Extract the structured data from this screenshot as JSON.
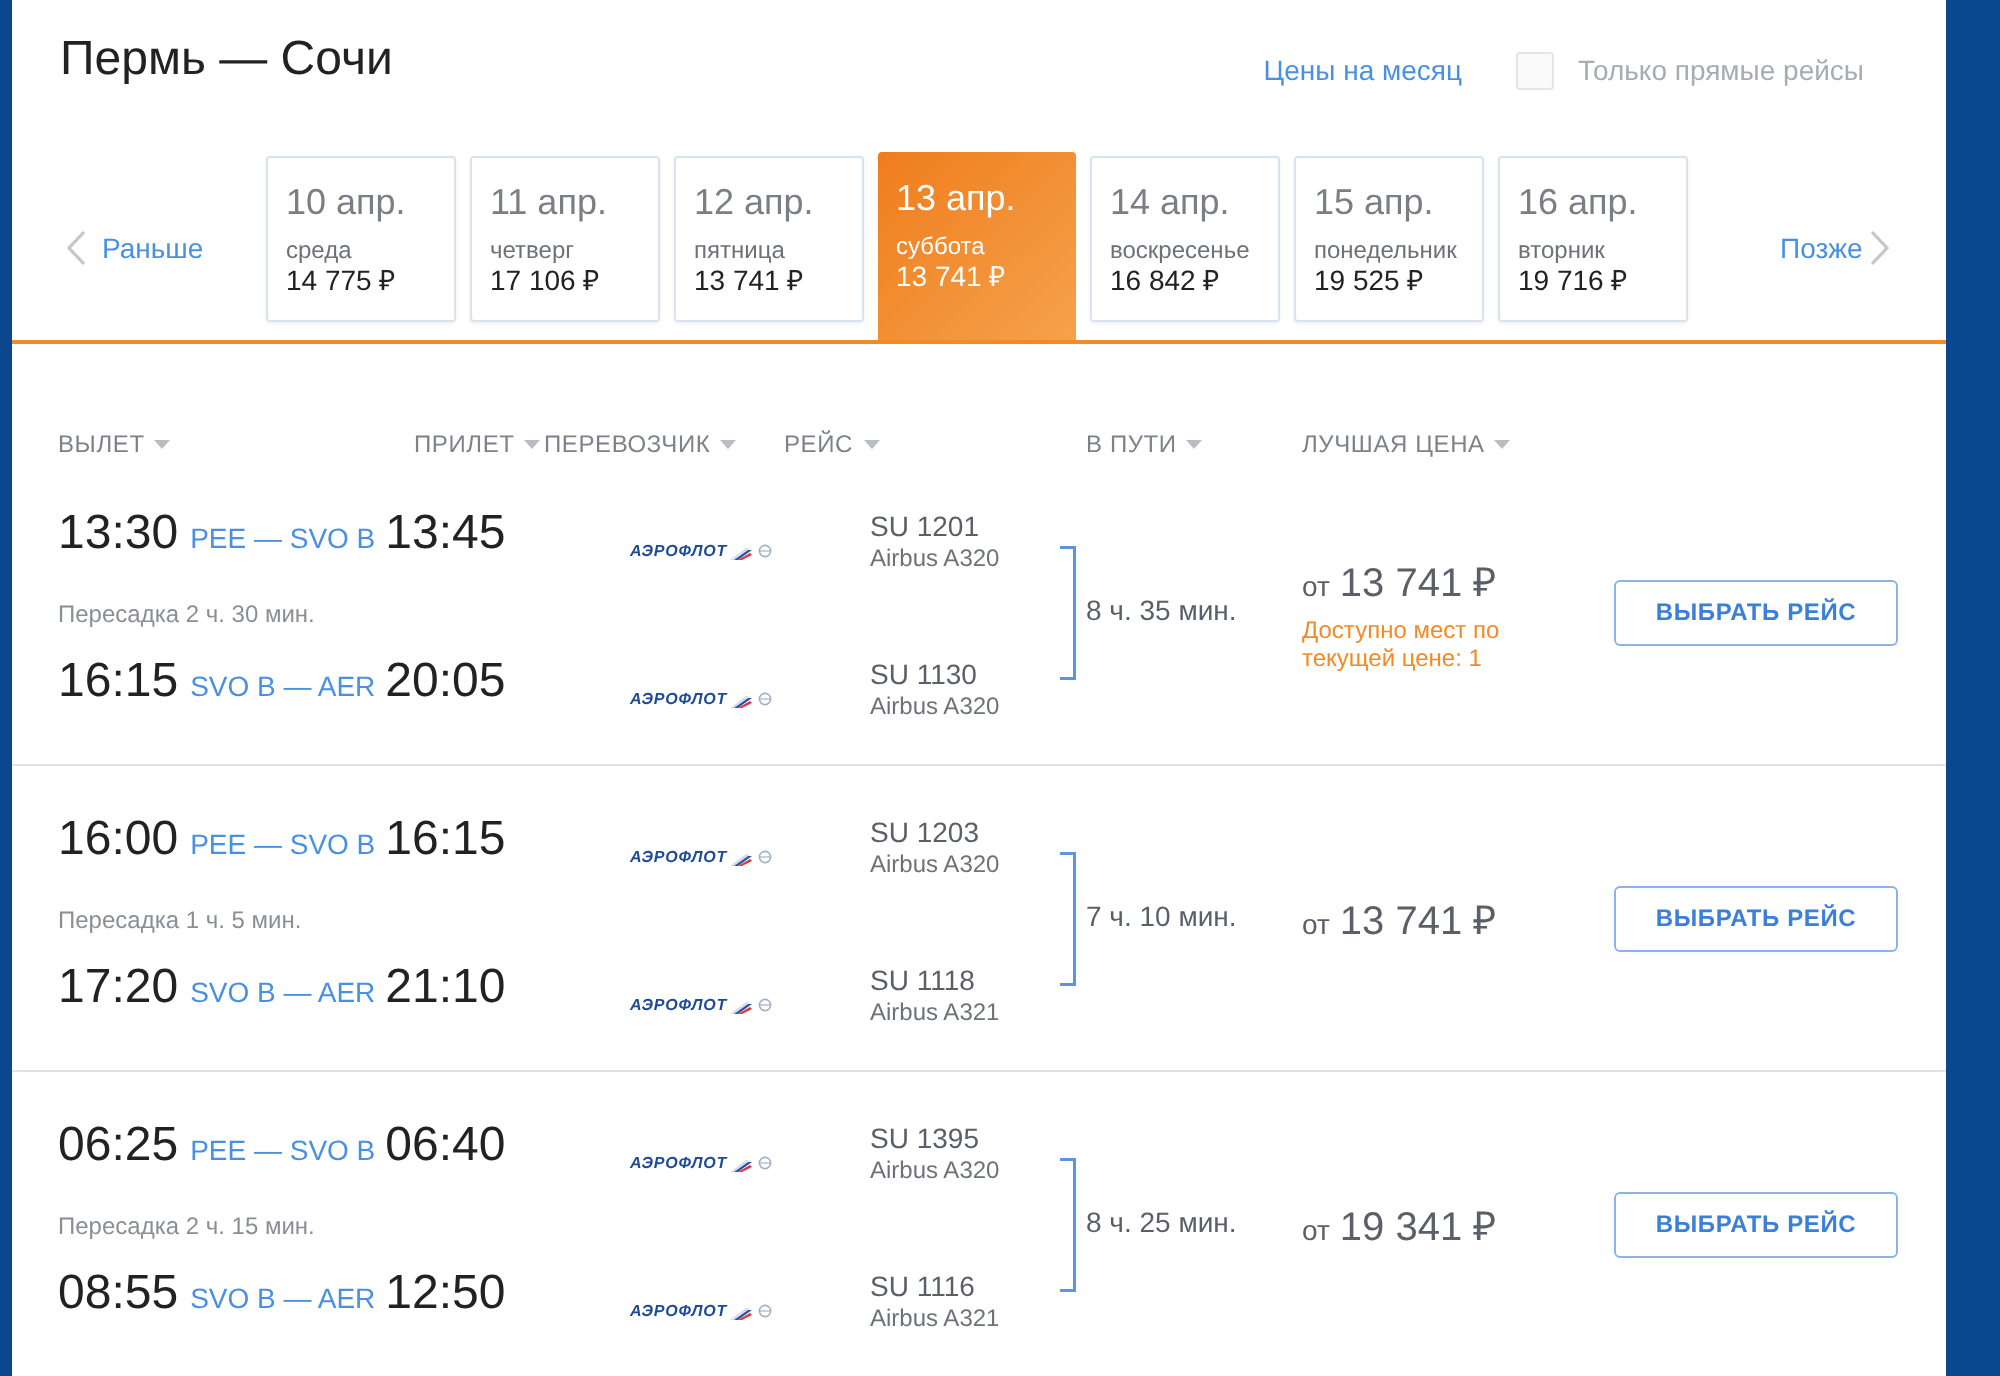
{
  "route_title": "Пермь — Сочи",
  "month_prices_link": "Цены на месяц",
  "direct_only": {
    "label": "Только прямые рейсы",
    "checked": false
  },
  "date_nav": {
    "earlier": "Раньше",
    "later": "Позже"
  },
  "dates": [
    {
      "date": "10 апр.",
      "weekday": "среда",
      "price": "14 775 ₽",
      "selected": false
    },
    {
      "date": "11 апр.",
      "weekday": "четверг",
      "price": "17 106 ₽",
      "selected": false
    },
    {
      "date": "12 апр.",
      "weekday": "пятница",
      "price": "13 741 ₽",
      "selected": false
    },
    {
      "date": "13 апр.",
      "weekday": "суббота",
      "price": "13 741 ₽",
      "selected": true
    },
    {
      "date": "14 апр.",
      "weekday": "воскресенье",
      "price": "16 842 ₽",
      "selected": false
    },
    {
      "date": "15 апр.",
      "weekday": "понедельник",
      "price": "19 525 ₽",
      "selected": false
    },
    {
      "date": "16 апр.",
      "weekday": "вторник",
      "price": "19 716 ₽",
      "selected": false
    }
  ],
  "columns": [
    "ВЫЛЕТ",
    "ПРИЛЕТ",
    "ПЕРЕВОЗЧИК",
    "РЕЙС",
    "В ПУТИ",
    "ЛУЧШАЯ ЦЕНА"
  ],
  "flights": [
    {
      "legs": [
        {
          "departure": "13:30",
          "route": "PEE — SVO B",
          "arrival": "13:45",
          "carrier": "АЭРОФЛОТ",
          "flight": "SU 1201",
          "aircraft": "Airbus A320"
        },
        {
          "departure": "16:15",
          "route": "SVO B — AER",
          "arrival": "20:05",
          "carrier": "АЭРОФЛОТ",
          "flight": "SU 1130",
          "aircraft": "Airbus A320"
        }
      ],
      "transfer": "Пересадка 2 ч. 30 мин.",
      "duration": "8 ч. 35 мин.",
      "price_prefix": "от",
      "price": "13 741 ₽",
      "availability": "Доступно мест по текущей цене: 1",
      "button": "ВЫБРАТЬ РЕЙС"
    },
    {
      "legs": [
        {
          "departure": "16:00",
          "route": "PEE — SVO B",
          "arrival": "16:15",
          "carrier": "АЭРОФЛОТ",
          "flight": "SU 1203",
          "aircraft": "Airbus A320"
        },
        {
          "departure": "17:20",
          "route": "SVO B — AER",
          "arrival": "21:10",
          "carrier": "АЭРОФЛОТ",
          "flight": "SU 1118",
          "aircraft": "Airbus A321"
        }
      ],
      "transfer": "Пересадка 1 ч. 5 мин.",
      "duration": "7 ч. 10 мин.",
      "price_prefix": "от",
      "price": "13 741 ₽",
      "button": "ВЫБРАТЬ РЕЙС"
    },
    {
      "legs": [
        {
          "departure": "06:25",
          "route": "PEE — SVO B",
          "arrival": "06:40",
          "carrier": "АЭРОФЛОТ",
          "flight": "SU 1395",
          "aircraft": "Airbus A320"
        },
        {
          "departure": "08:55",
          "route": "SVO B — AER",
          "arrival": "12:50",
          "carrier": "АЭРОФЛОТ",
          "flight": "SU 1116",
          "aircraft": "Airbus A321"
        }
      ],
      "transfer": "Пересадка 2 ч. 15 мин.",
      "duration": "8 ч. 25 мин.",
      "price_prefix": "от",
      "price": "19 341 ₽",
      "button": "ВЫБРАТЬ РЕЙС"
    }
  ]
}
